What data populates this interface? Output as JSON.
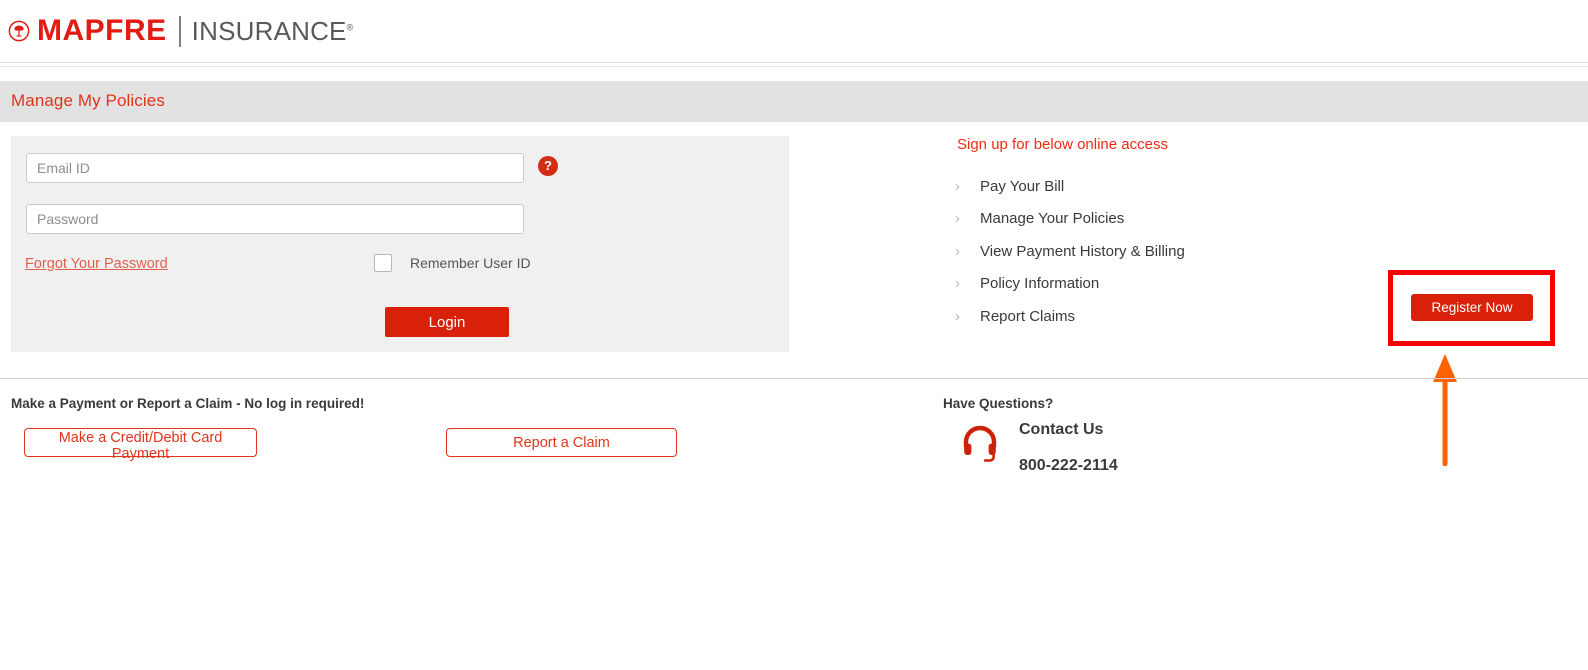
{
  "header": {
    "logo_mark": "mapfre-tree-emblem",
    "brand_primary": "MAPFRE",
    "brand_secondary": "INSURANCE",
    "brand_registered_mark": "®"
  },
  "title_band": {
    "title": "Manage My Policies"
  },
  "login": {
    "email_placeholder": "Email ID",
    "email_value": "",
    "password_placeholder": "Password",
    "password_value": "",
    "help_badge": "?",
    "forgot_password_label": "Forgot Your Password",
    "remember_label": "Remember User ID",
    "remember_checked": false,
    "login_label": "Login"
  },
  "signup": {
    "title": "Sign up for below online access",
    "items": [
      {
        "label": "Pay Your Bill"
      },
      {
        "label": "Manage Your Policies"
      },
      {
        "label": "View Payment History & Billing"
      },
      {
        "label": "Policy Information"
      },
      {
        "label": "Report Claims"
      }
    ],
    "register_label": "Register Now"
  },
  "no_login": {
    "heading": "Make a Payment or Report a Claim - No log in required!",
    "payment_button": "Make a Credit/Debit Card Payment",
    "claim_button": "Report a Claim"
  },
  "contact": {
    "heading": "Have Questions?",
    "icon": "headset-icon",
    "contact_label": "Contact Us",
    "phone": "800-222-2114"
  },
  "colors": {
    "brand_red": "#e31b13",
    "button_red": "#d9200b",
    "title_red": "#e0351b",
    "annotation_red": "#f60000",
    "annotation_arrow_orange": "#ff6200",
    "band_gray": "#e2e2e2",
    "panel_gray": "#f0f0f0",
    "brand_gray": "#58595b"
  }
}
